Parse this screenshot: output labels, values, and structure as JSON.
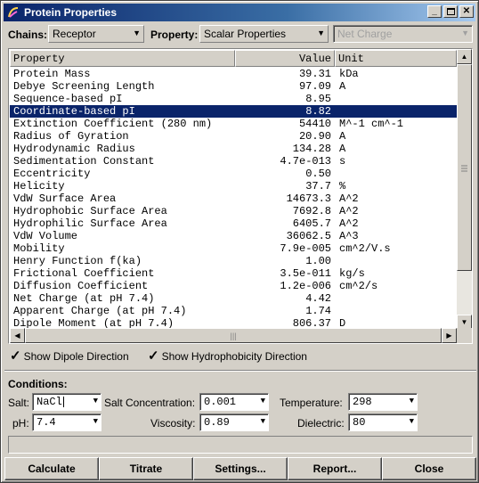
{
  "window": {
    "title": "Protein Properties"
  },
  "toolbar": {
    "chains_label": "Chains:",
    "chains_value": "Receptor",
    "property_label": "Property:",
    "property_value": "Scalar Properties",
    "subproperty_value": "Net Charge"
  },
  "table": {
    "columns": [
      "Property",
      "Value",
      "Unit"
    ],
    "rows": [
      {
        "property": "Protein Mass",
        "value": "39.31",
        "unit": "kDa"
      },
      {
        "property": "Debye Screening Length",
        "value": "97.09",
        "unit": "A"
      },
      {
        "property": "Sequence-based pI",
        "value": "8.95",
        "unit": ""
      },
      {
        "property": "Coordinate-based pI",
        "value": "8.82",
        "unit": "",
        "selected": true
      },
      {
        "property": "Extinction Coefficient (280 nm)",
        "value": "54410",
        "unit": "M^-1 cm^-1"
      },
      {
        "property": "Radius of Gyration",
        "value": "20.90",
        "unit": "A"
      },
      {
        "property": "Hydrodynamic Radius",
        "value": "134.28",
        "unit": "A"
      },
      {
        "property": "Sedimentation Constant",
        "value": "4.7e-013",
        "unit": "s"
      },
      {
        "property": "Eccentricity",
        "value": "0.50",
        "unit": ""
      },
      {
        "property": "Helicity",
        "value": "37.7",
        "unit": "%"
      },
      {
        "property": "VdW Surface Area",
        "value": "14673.3",
        "unit": "A^2"
      },
      {
        "property": "Hydrophobic Surface Area",
        "value": "7692.8",
        "unit": "A^2"
      },
      {
        "property": "Hydrophilic Surface Area",
        "value": "6405.7",
        "unit": "A^2"
      },
      {
        "property": "VdW Volume",
        "value": "36062.5",
        "unit": "A^3"
      },
      {
        "property": "Mobility",
        "value": "7.9e-005",
        "unit": "cm^2/V.s"
      },
      {
        "property": "Henry Function f(ka)",
        "value": "1.00",
        "unit": ""
      },
      {
        "property": "Frictional Coefficient",
        "value": "3.5e-011",
        "unit": "kg/s"
      },
      {
        "property": "Diffusion Coefficient",
        "value": "1.2e-006",
        "unit": "cm^2/s"
      },
      {
        "property": "Net Charge (at pH 7.4)",
        "value": "4.42",
        "unit": ""
      },
      {
        "property": "Apparent Charge (at pH 7.4)",
        "value": "1.74",
        "unit": ""
      },
      {
        "property": "Dipole Moment (at pH 7.4)",
        "value": "806.37",
        "unit": "D"
      }
    ]
  },
  "options": {
    "show_dipole": "Show Dipole Direction",
    "show_hydrophobicity": "Show Hydrophobicity Direction"
  },
  "conditions": {
    "heading": "Conditions:",
    "salt_label": "Salt:",
    "salt_value": "NaCl",
    "salt_conc_label": "Salt Concentration:",
    "salt_conc_value": "0.001",
    "temperature_label": "Temperature:",
    "temperature_value": "298",
    "ph_label": "pH:",
    "ph_value": "7.4",
    "viscosity_label": "Viscosity:",
    "viscosity_value": "0.89",
    "dielectric_label": "Dielectric:",
    "dielectric_value": "80"
  },
  "buttons": {
    "calculate": "Calculate",
    "titrate": "Titrate",
    "settings": "Settings...",
    "report": "Report...",
    "close": "Close"
  }
}
